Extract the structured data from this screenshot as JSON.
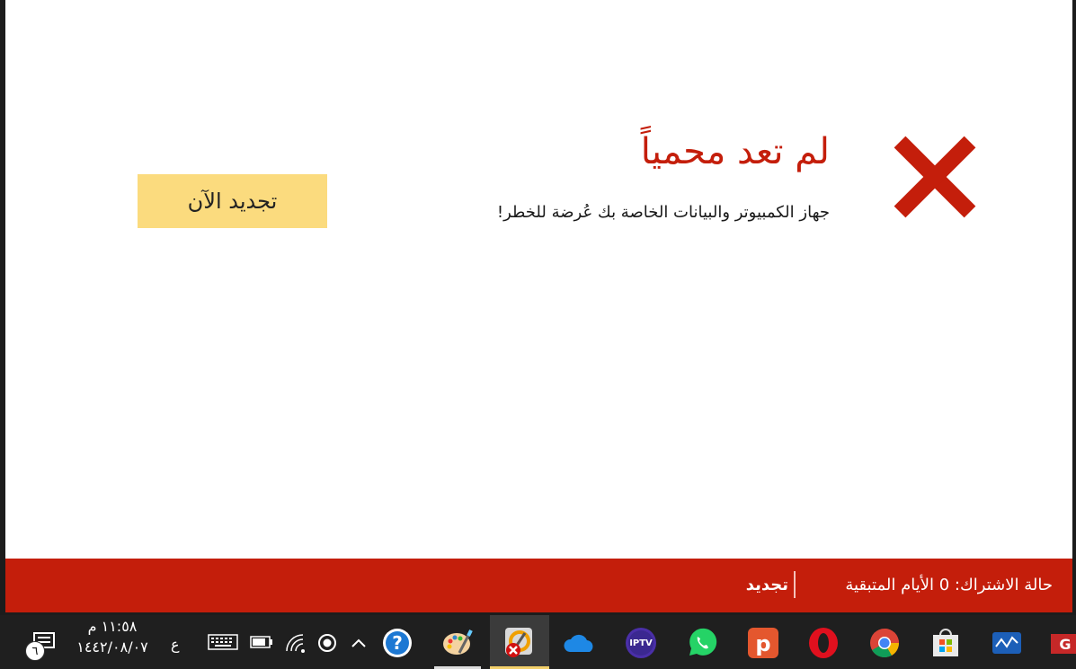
{
  "main": {
    "title": "لم تعد محمياً",
    "subtitle": "جهاز الكمبيوتر والبيانات الخاصة بك عُرضة للخطر!",
    "renew_button": "تجديد الآن",
    "status_icon": "error-x-icon",
    "accent_color": "#c41e0b",
    "button_color": "#fbdb7e"
  },
  "status_bar": {
    "subscription_label": "حالة الاشتراك:",
    "days_value": "0",
    "days_label": "الأيام المتبقية",
    "renew_link": "تجديد"
  },
  "taskbar": {
    "time": "١١:٥٨ م",
    "date": "١٤٤٢/٠٨/٠٧",
    "language": "ع",
    "notification_count": "٦",
    "tray_icons": [
      "keyboard-icon",
      "battery-icon",
      "wifi-icon",
      "record-icon",
      "chevron-up-icon",
      "help-icon"
    ],
    "apps": [
      "paint-icon",
      "security-app-icon",
      "onedrive-icon",
      "iptv-icon",
      "whatsapp-icon",
      "psiphon-icon",
      "opera-icon",
      "chrome-icon",
      "store-icon",
      "whiteboard-icon",
      "mail-icon"
    ]
  }
}
